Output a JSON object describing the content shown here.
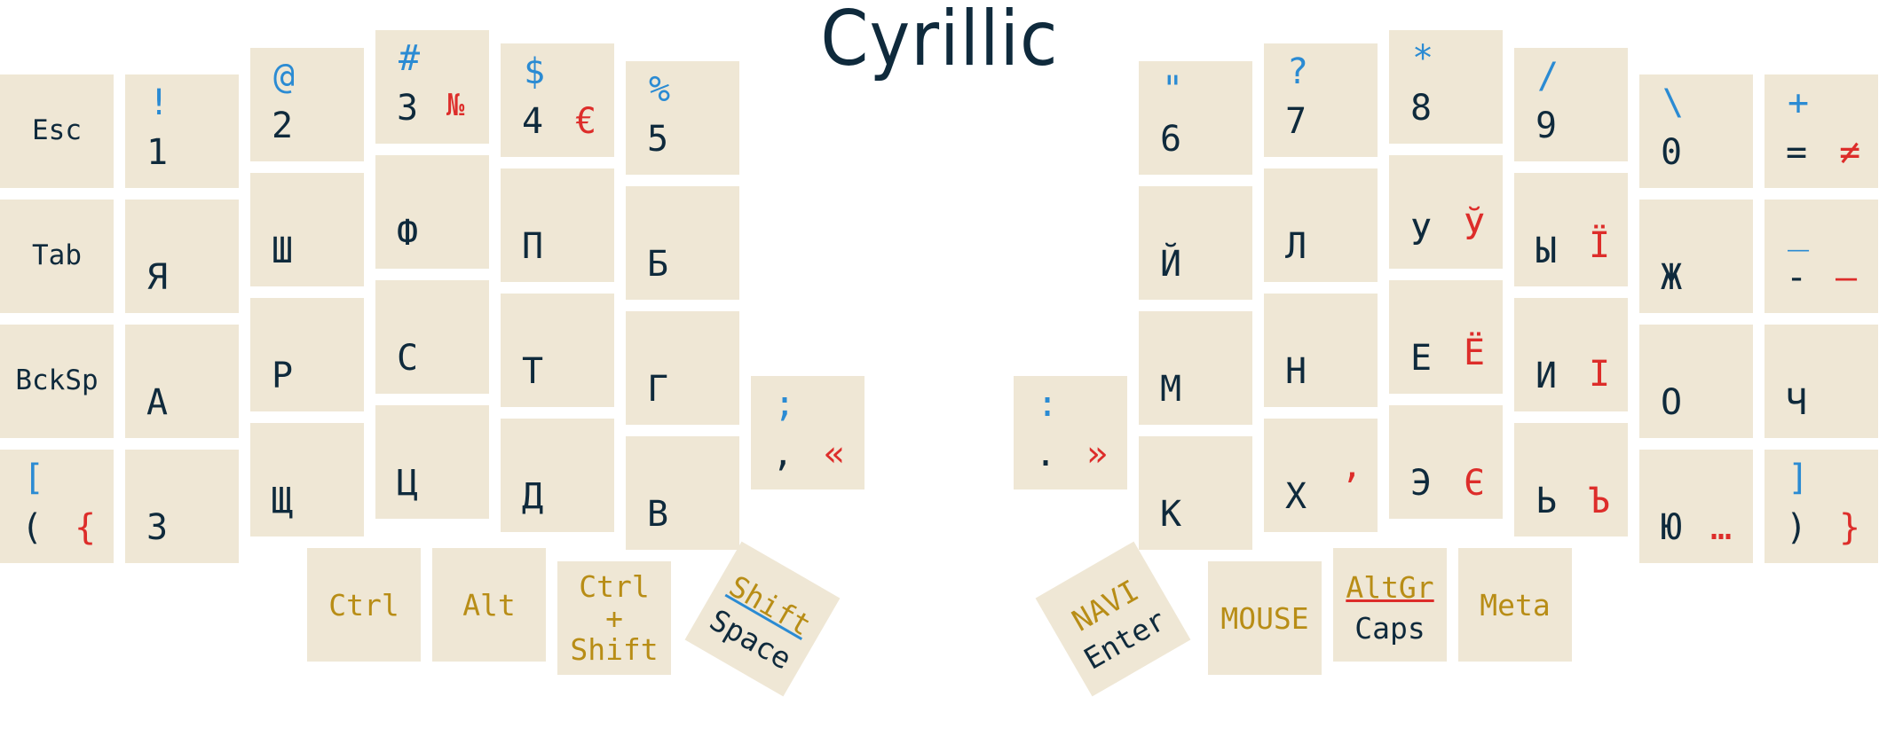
{
  "title": "Cyrillic",
  "keys": {
    "esc": {
      "label": "Esc"
    },
    "tab": {
      "label": "Tab"
    },
    "bksp": {
      "label": "BckSp"
    },
    "paren": {
      "sym": "[",
      "main": "(",
      "alt": "{"
    },
    "k1": {
      "sym": "!",
      "main": "1"
    },
    "ya": {
      "main": "Я"
    },
    "a": {
      "main": "А"
    },
    "ze": {
      "main": "З"
    },
    "k2": {
      "sym": "@",
      "main": "2"
    },
    "sha": {
      "main": "Ш"
    },
    "er": {
      "main": "Р"
    },
    "shcha": {
      "main": "Щ"
    },
    "k3": {
      "sym": "#",
      "main": "3",
      "alt": "№"
    },
    "ef": {
      "main": "Ф"
    },
    "es": {
      "main": "С"
    },
    "tse": {
      "main": "Ц"
    },
    "k4": {
      "sym": "$",
      "main": "4",
      "alt": "€"
    },
    "pe": {
      "main": "П"
    },
    "te": {
      "main": "Т"
    },
    "de": {
      "main": "Д"
    },
    "k5": {
      "sym": "%",
      "main": "5"
    },
    "be": {
      "main": "Б"
    },
    "ge": {
      "main": "Г"
    },
    "ve": {
      "main": "В"
    },
    "comma": {
      "sym": ";",
      "main": ",",
      "alt": "«"
    },
    "period": {
      "sym": ":",
      "main": ".",
      "alt": "»"
    },
    "k6": {
      "sym": "\"",
      "main": "6"
    },
    "ishort": {
      "main": "Й"
    },
    "em": {
      "main": "М"
    },
    "ka": {
      "main": "К"
    },
    "k7": {
      "sym": "?",
      "main": "7"
    },
    "el": {
      "main": "Л"
    },
    "en": {
      "main": "Н"
    },
    "kha": {
      "main": "Х",
      "alt": "’"
    },
    "k8": {
      "sym": "*",
      "main": "8"
    },
    "u": {
      "main": "У",
      "alt": "Ў"
    },
    "ie": {
      "main": "Е",
      "alt": "Ё"
    },
    "e": {
      "main": "Э",
      "alt": "Є"
    },
    "k9": {
      "sym": "/",
      "main": "9"
    },
    "yery": {
      "main": "Ы",
      "alt": "Ї"
    },
    "i": {
      "main": "И",
      "alt": "І"
    },
    "soft": {
      "main": "Ь",
      "alt": "Ъ"
    },
    "k0": {
      "sym": "\\",
      "main": "0"
    },
    "zhe": {
      "main": "Ж"
    },
    "o": {
      "main": "О"
    },
    "yu": {
      "main": "Ю",
      "alt": "…"
    },
    "equals": {
      "sym": "+",
      "main": "=",
      "alt": "≠"
    },
    "minus": {
      "sym": "_",
      "main": "-",
      "alt": "—"
    },
    "che": {
      "main": "Ч"
    },
    "rparen": {
      "sym": "]",
      "main": ")",
      "alt": "}"
    },
    "ctrl": {
      "label": "Ctrl"
    },
    "alt_key": {
      "label": "Alt"
    },
    "ctrlshift": {
      "line1": "Ctrl",
      "line2": "+",
      "line3": "Shift"
    },
    "space": {
      "hold": "Shift",
      "tap": "Space"
    },
    "enter": {
      "hold": "NAVI",
      "tap": "Enter"
    },
    "mouse": {
      "label": "MOUSE"
    },
    "caps": {
      "hold": "AltGr",
      "tap": "Caps"
    },
    "meta": {
      "label": "Meta"
    }
  }
}
